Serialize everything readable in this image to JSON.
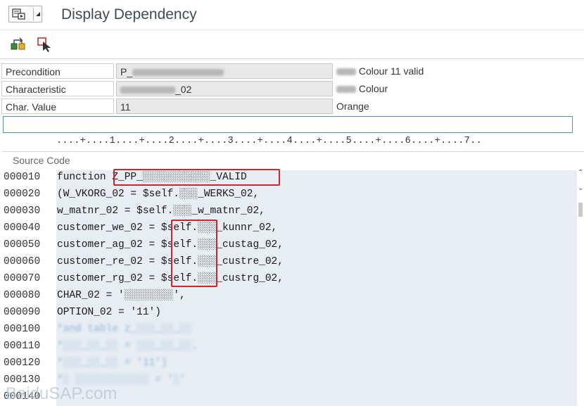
{
  "window": {
    "title": "Display Dependency"
  },
  "toolbar": {
    "icons": [
      "change-display-icon",
      "object-selector-icon"
    ]
  },
  "form": {
    "rows": [
      {
        "label": "Precondition",
        "value": "P_",
        "value_blurred": true,
        "desc_prefix_blurred": true,
        "desc": "Colour 11 valid"
      },
      {
        "label": "Characteristic",
        "value": "_02",
        "value_blurred": true,
        "desc_prefix_blurred": true,
        "desc": "Colour"
      },
      {
        "label": "Char. Value",
        "value": "11",
        "value_blurred": false,
        "desc_prefix_blurred": false,
        "desc": "Orange"
      }
    ]
  },
  "ruler": "....+....1....+....2....+....3....+....4....+....5....+....6....+....7..",
  "editor": {
    "section_label": "Source Code",
    "lines": [
      {
        "no": "000010",
        "code": "function Z_PP_░░░░░░░░░░░_VALID"
      },
      {
        "no": "000020",
        "code": "(W_VKORG_02 = $self.░░░_WERKS_02,"
      },
      {
        "no": "000030",
        "code": "w_matnr_02 = $self.░░░_w_matnr_02,"
      },
      {
        "no": "000040",
        "code": "customer_we_02 = $self.░░░_kunnr_02,"
      },
      {
        "no": "000050",
        "code": "customer_ag_02 = $self.░░░_custag_02,"
      },
      {
        "no": "000060",
        "code": "customer_re_02 = $self.░░░_custre_02,"
      },
      {
        "no": "000070",
        "code": "customer_rg_02 = $self.░░░_custrg_02,"
      },
      {
        "no": "000080",
        "code": "CHAR_02 = '░░░░░░░░',"
      },
      {
        "no": "000090",
        "code": "OPTION_02 = '11')"
      },
      {
        "no": "000100",
        "code": "*and table z_░░░_░░_░░",
        "comment": true
      },
      {
        "no": "000110",
        "code": "*░░░_░░_░░ = ░░░_░░_░░.",
        "comment": true
      },
      {
        "no": "000120",
        "code": "*░░░_░░_░░ = '11')",
        "comment": true
      },
      {
        "no": "000130",
        "code": "*░ ░░░░░░░░░░░░ = '░'",
        "comment": true
      },
      {
        "no": "000140",
        "code": ""
      }
    ]
  },
  "watermark": "BaiduSAP.com",
  "colors": {
    "highlight": "#d3232a",
    "code_bg": "#e7edf3",
    "field_bg": "#e8e8e8"
  }
}
